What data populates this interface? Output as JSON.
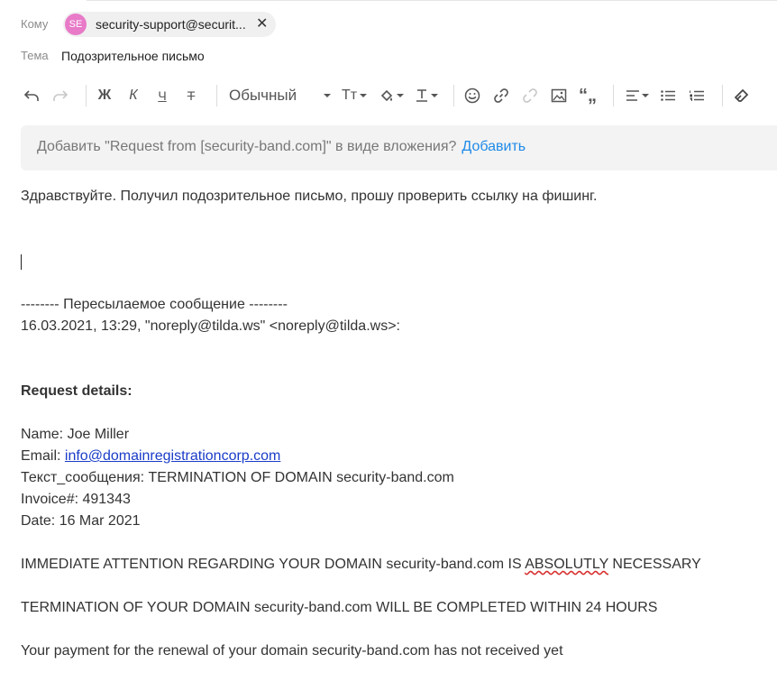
{
  "compose": {
    "to_label": "Кому",
    "recipient": {
      "avatar": "SE",
      "avatar_color": "#e87ac8",
      "email": "security-support@securit..."
    },
    "subject_label": "Тема",
    "subject": "Подозрительное письмо"
  },
  "toolbar": {
    "undo": "↶",
    "redo": "↷",
    "bold": "Ж",
    "italic": "К",
    "underline": "Ч",
    "strike": "Т",
    "style": "Обычный",
    "font_size": "Тт",
    "clear_format": "⌫"
  },
  "banner": {
    "text": "Добавить \"Request from [security-band.com]\" в виде вложения?",
    "action": "Добавить",
    "link_color": "#1f8ae8"
  },
  "body": {
    "greeting": "Здравствуйте. Получил подозрительное письмо, прошу проверить ссылку на фишинг.",
    "forward_header": "-------- Пересылаемое сообщение --------",
    "forward_meta": "16.03.2021, 13:29, \"noreply@tilda.ws\" <noreply@tilda.ws>:",
    "request_details": "Request details:",
    "name_line": "Name: Joe Miller",
    "email_label": "Email: ",
    "email_link": "info@domainregistrationcorp.com",
    "text_line": "Текст_сообщения: TERMINATION OF DOMAIN security-band.com",
    "invoice_line": "Invoice#: 491343",
    "date_line": "Date: 16 Mar 2021",
    "attention_a": "IMMEDIATE ATTENTION REGARDING YOUR DOMAIN security-band.com IS ",
    "attention_misspelled": "ABSOLUTLY",
    "attention_b": " NECESSARY",
    "termination_line": "TERMINATION OF YOUR DOMAIN security-band.com WILL BE COMPLETED WITHIN 24 HOURS",
    "payment_line": "Your payment for the renewal of your domain security-band.com has not received yet"
  }
}
